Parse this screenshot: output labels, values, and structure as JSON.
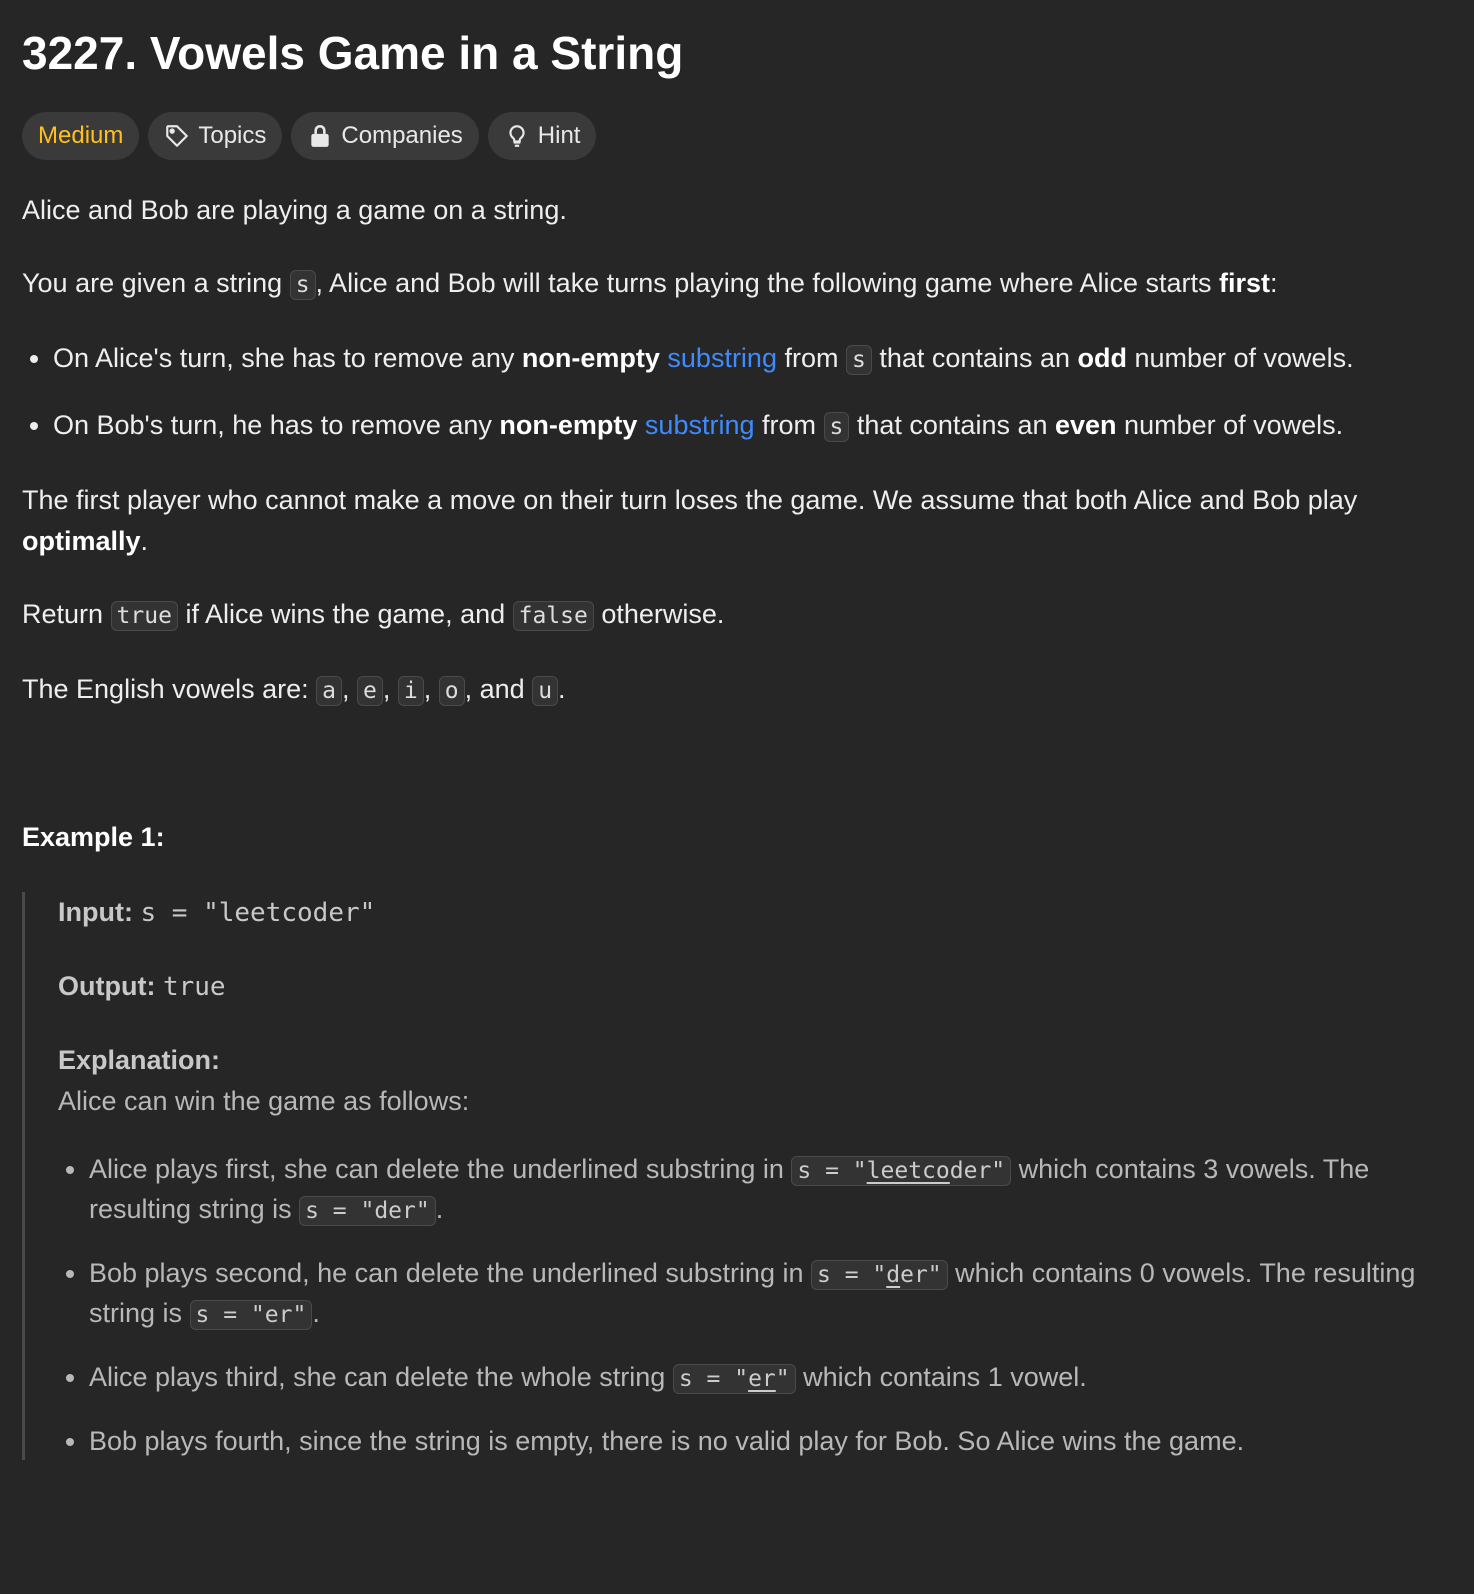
{
  "problem": {
    "title": "3227. Vowels Game in a String"
  },
  "tags": {
    "difficulty": "Medium",
    "topics": "Topics",
    "companies": "Companies",
    "hint": "Hint"
  },
  "description": {
    "p1": "Alice and Bob are playing a game on a string.",
    "p2_a": "You are given a string ",
    "p2_code": "s",
    "p2_b": ", Alice and Bob will take turns playing the following game where Alice starts ",
    "p2_bold": "first",
    "p2_c": ":",
    "rule1_a": "On Alice's turn, she has to remove any ",
    "rule1_bold1": "non-empty",
    "rule1_link": "substring",
    "rule1_b": " from ",
    "rule1_code": "s",
    "rule1_c": " that contains an ",
    "rule1_bold2": "odd",
    "rule1_d": " number of vowels.",
    "rule2_a": "On Bob's turn, he has to remove any ",
    "rule2_bold1": "non-empty",
    "rule2_link": "substring",
    "rule2_b": " from ",
    "rule2_code": "s",
    "rule2_c": " that contains an ",
    "rule2_bold2": "even",
    "rule2_d": " number of vowels.",
    "p3_a": "The first player who cannot make a move on their turn loses the game. We assume that both Alice and Bob play ",
    "p3_bold": "optimally",
    "p3_b": ".",
    "p4_a": "Return ",
    "p4_code1": "true",
    "p4_b": " if Alice wins the game, and ",
    "p4_code2": "false",
    "p4_c": " otherwise.",
    "p5_a": "The English vowels are: ",
    "v1": "a",
    "v2": "e",
    "v3": "i",
    "v4": "o",
    "v5": "u",
    "sep": ", ",
    "and": ", and ",
    "p5_end": "."
  },
  "example1": {
    "title": "Example 1:",
    "input_label": "Input:",
    "input_value": "s = \"leetcoder\"",
    "output_label": "Output:",
    "output_value": "true",
    "explanation_label": "Explanation:",
    "explanation_intro": "Alice can win the game as follows:",
    "s1_a": "Alice plays first, she can delete the underlined substring in ",
    "s1_code_pre": "s = \"",
    "s1_code_u": "leetco",
    "s1_code_post": "der\"",
    "s1_b": " which contains 3 vowels. The resulting string is ",
    "s1_code2": "s = \"der\"",
    "s1_c": ".",
    "s2_a": "Bob plays second, he can delete the underlined substring in ",
    "s2_code_pre": "s = \"",
    "s2_code_u": "d",
    "s2_code_post": "er\"",
    "s2_b": " which contains 0 vowels. The resulting string is ",
    "s2_code2": "s = \"er\"",
    "s2_c": ".",
    "s3_a": "Alice plays third, she can delete the whole string ",
    "s3_code_pre": "s = \"",
    "s3_code_u": "er",
    "s3_code_post": "\"",
    "s3_b": " which contains 1 vowel.",
    "s4": "Bob plays fourth, since the string is empty, there is no valid play for Bob. So Alice wins the game."
  }
}
